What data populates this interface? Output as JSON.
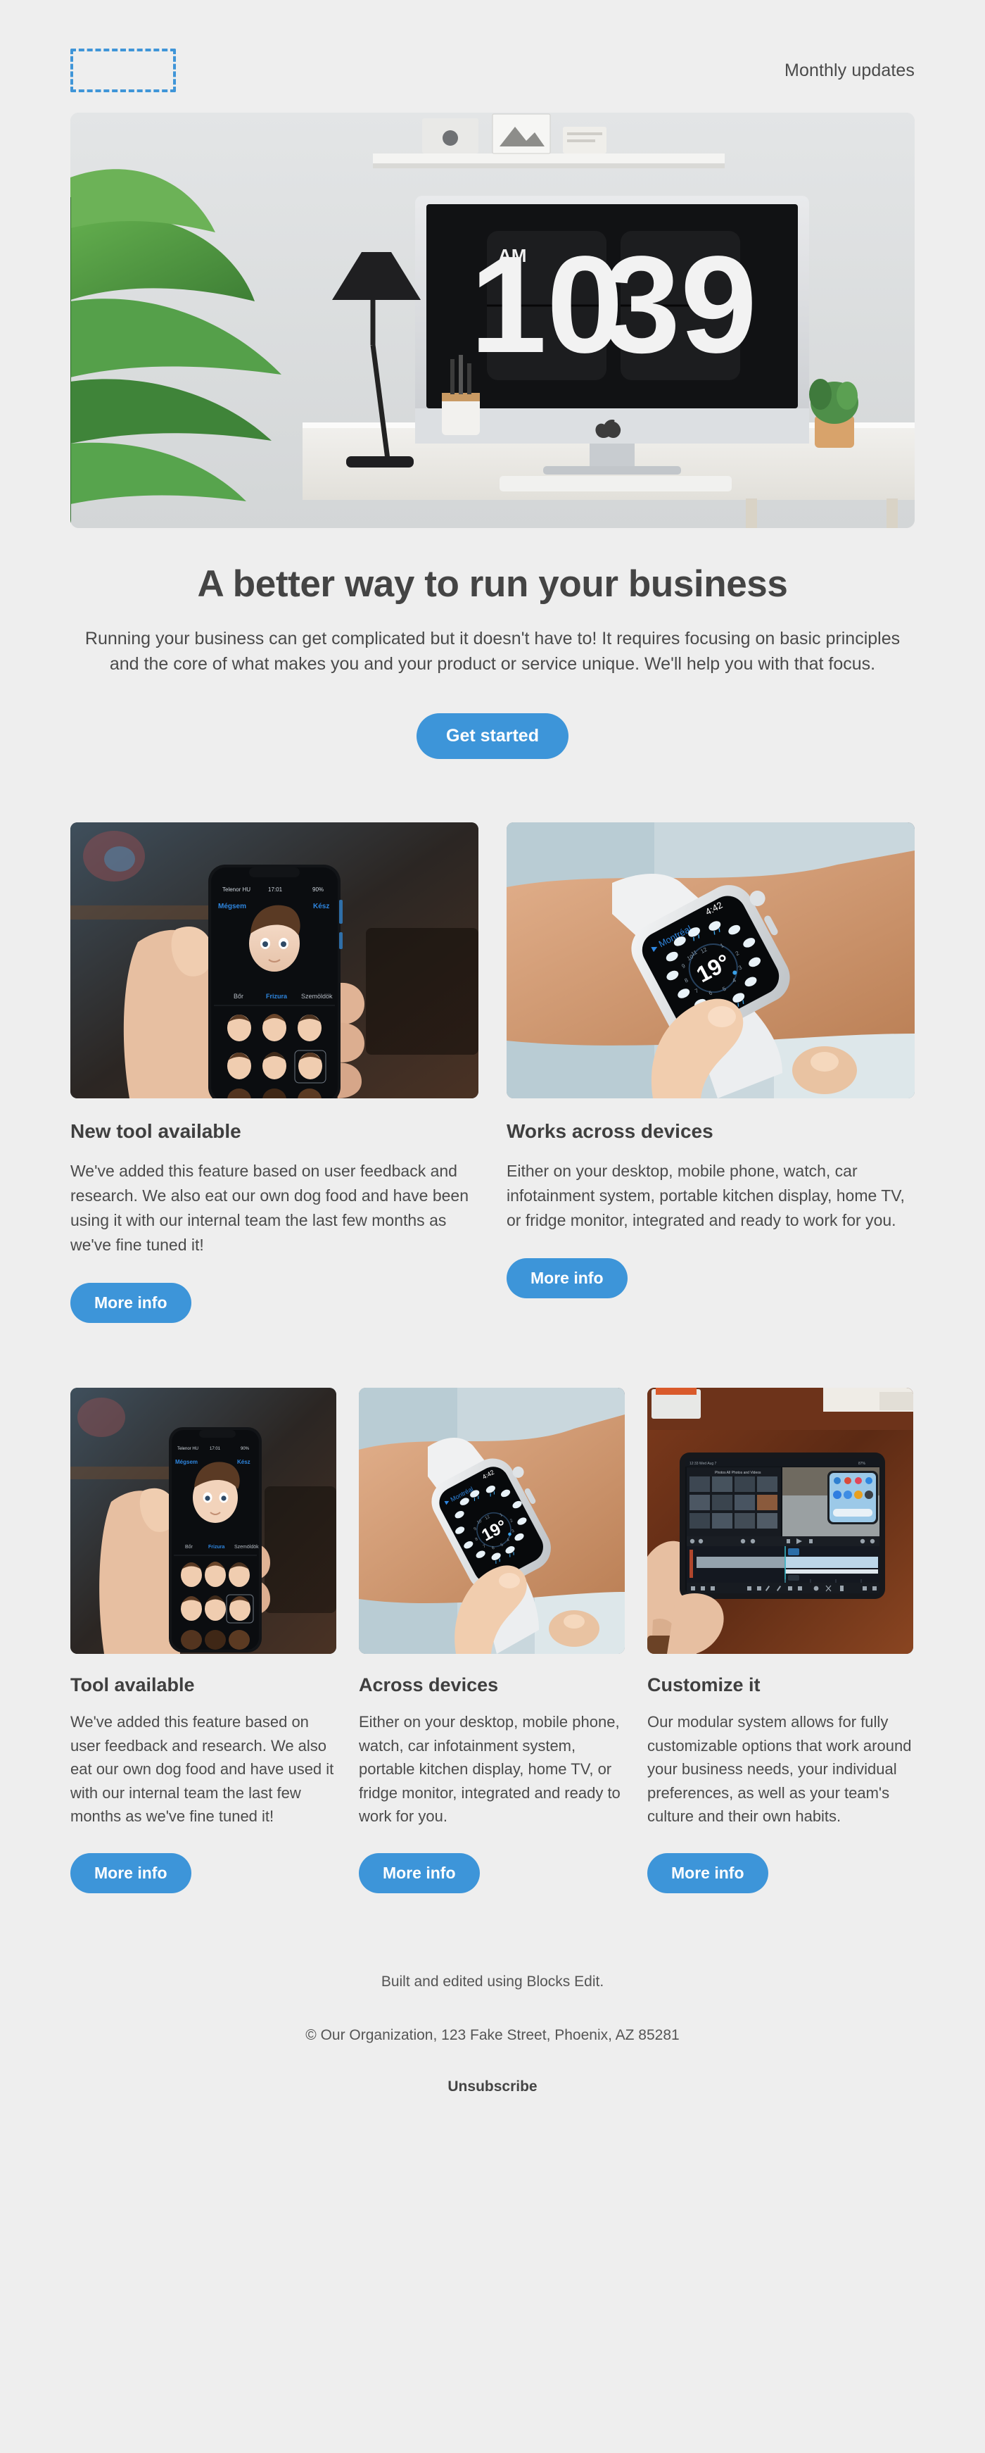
{
  "theme": {
    "page_background": "#eeeeee",
    "accent_blue": "#3d95d9",
    "heading_color": "#444444",
    "body_color": "#4b4b4b"
  },
  "header": {
    "logo_placeholder_label": "",
    "tagline": "Monthly updates"
  },
  "hero": {
    "image": {
      "alt": "iMac on a white desk showing a large flip clock, with a desk lamp, plant and small potted cactus",
      "screen_time_meridiem": "AM",
      "screen_time_hours": "10",
      "screen_time_minutes": "39"
    },
    "title": "A better way to run your business",
    "body": "Running your business can get complicated but it doesn't have to! It requires focusing on basic principles and the core of what makes you and your product or service unique. We'll help you with that focus.",
    "cta_label": "Get started"
  },
  "two_column": [
    {
      "image_alt": "Hand holding an iPhone showing the Memoji creation screen",
      "image_kind": "phone-memoji",
      "heading": "New tool available",
      "body": "We've added this feature based on user feedback and research. We also eat our own dog food and have been using it with our internal team the last few months as we've fine tuned it!",
      "button_label": "More info"
    },
    {
      "image_alt": "Wrist wearing an Apple Watch showing the Montreal weather face",
      "image_kind": "watch-weather",
      "heading": "Works across devices",
      "body": "Either on your desktop, mobile phone, watch, car infotainment system, portable kitchen display, home TV, or fridge monitor, integrated and ready to work for you.",
      "button_label": "More info"
    }
  ],
  "three_column": [
    {
      "image_alt": "Hand holding an iPhone showing the Memoji creation screen",
      "image_kind": "phone-memoji",
      "heading": "Tool available",
      "body": "We've added this feature based on user feedback and research. We also eat our own dog food and have used it with our internal team the last few months as we've fine tuned it!",
      "button_label": "More info"
    },
    {
      "image_alt": "Wrist wearing an Apple Watch showing the Montreal weather face",
      "image_kind": "watch-weather",
      "heading": "Across devices",
      "body": "Either on your desktop, mobile phone, watch, car infotainment system, portable kitchen display, home TV, or fridge monitor, integrated and ready to work for you.",
      "button_label": "More info"
    },
    {
      "image_alt": "Hands holding an iPad running a video editing timeline on a wooden desk",
      "image_kind": "tablet-editor",
      "heading": "Customize it",
      "body": "Our modular system allows for fully customizable options that work around your business needs, your individual preferences, as well as your team's culture and their own habits.",
      "button_label": "More info"
    }
  ],
  "footer": {
    "built_with": "Built and edited using Blocks Edit.",
    "copyright": "© Our Organization, 123 Fake Street, Phoenix, AZ 85281",
    "unsubscribe_label": "Unsubscribe"
  },
  "watch_image_detail": {
    "city": "Montréal",
    "time": "4:42",
    "temperature": "19°"
  }
}
